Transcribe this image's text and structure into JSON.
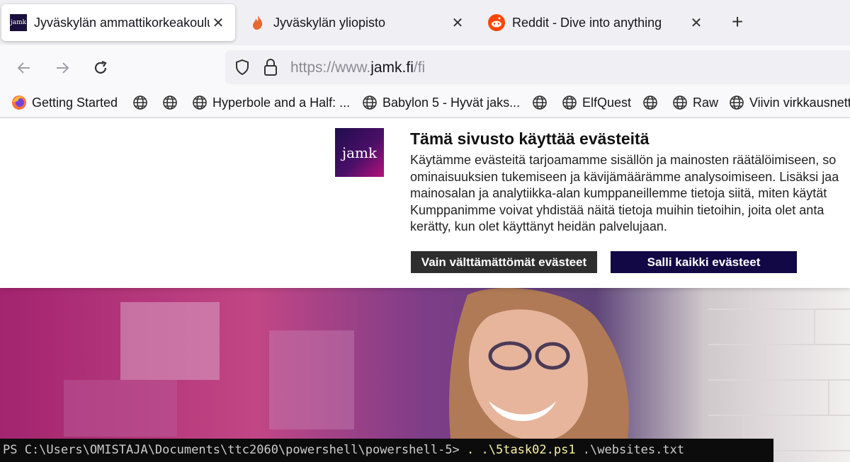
{
  "tabs": [
    {
      "title": "Jyväskylän ammattikorkeakoulu",
      "favicon": "jamk-icon",
      "active": true
    },
    {
      "title": "Jyväskylän yliopisto",
      "favicon": "flame-icon",
      "active": false
    },
    {
      "title": "Reddit - Dive into anything",
      "favicon": "reddit-icon",
      "active": false
    }
  ],
  "favicon_text": "jamk",
  "close_glyph": "✕",
  "new_tab_glyph": "+",
  "url": {
    "prefix": "https://www.",
    "domain": "jamk.fi",
    "path": "/fi"
  },
  "bookmarks": [
    {
      "label": "Getting Started",
      "icon": "firefox-icon"
    },
    {
      "label": "",
      "icon": "globe-icon"
    },
    {
      "label": "",
      "icon": "globe-icon"
    },
    {
      "label": "Hyperbole and a Half: ...",
      "icon": "globe-icon"
    },
    {
      "label": "Babylon 5 - Hyvät jaks...",
      "icon": "globe-icon"
    },
    {
      "label": "",
      "icon": "globe-icon"
    },
    {
      "label": "ElfQuest",
      "icon": "globe-icon"
    },
    {
      "label": "",
      "icon": "globe-icon"
    },
    {
      "label": "Raw",
      "icon": "globe-icon"
    },
    {
      "label": "Viivin virkkausnett",
      "icon": "globe-icon"
    }
  ],
  "cookie": {
    "logo_text": "jamk",
    "title": "Tämä sivusto käyttää evästeitä",
    "lines": [
      "Käytämme evästeitä tarjoamamme sisällön ja mainosten räätälöimiseen, so",
      "ominaisuuksien tukemiseen ja kävijämäärämme analysoimiseen. Lisäksi jaa",
      "mainosalan ja analytiikka-alan kumppaneillemme tietoja siitä, miten käytät",
      "Kumppanimme voivat yhdistää näitä tietoja muihin tietoihin, joita olet anta",
      "kerätty, kun olet käyttänyt heidän palvelujaan."
    ],
    "btn_necessary": "Vain välttämättömät evästeet",
    "btn_allow": "Salli kaikki evästeet"
  },
  "terminal": {
    "prompt": "PS C:\\Users\\OMISTAJA\\Documents\\ttc2060\\powershell\\powershell-5> ",
    "command": ". .\\5task02.ps1",
    "args": " .\\websites.txt"
  },
  "colors": {
    "brand_dark": "#120845",
    "brand_magenta": "#b4127a"
  }
}
